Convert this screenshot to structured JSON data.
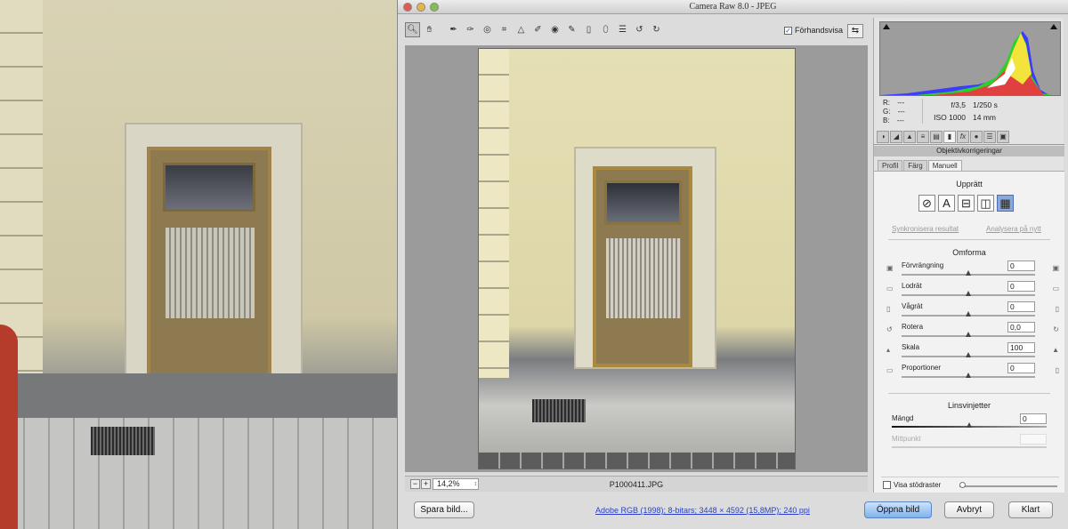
{
  "window": {
    "title": "Camera Raw 8.0  -  JPEG"
  },
  "toolbar": {
    "tools": [
      "zoom-icon",
      "hand-icon",
      "white-balance-icon",
      "color-sampler-icon",
      "targeted-adjust-icon",
      "crop-icon",
      "straighten-icon",
      "spot-removal-icon",
      "red-eye-icon",
      "adjustment-brush-icon",
      "graduated-filter-icon",
      "radial-filter-icon",
      "preferences-icon",
      "rotate-ccw-icon",
      "rotate-cw-icon"
    ],
    "preview_label": "Förhandsvisa",
    "preview_checked": true
  },
  "status": {
    "zoom": "14,2%",
    "filename": "P1000411.JPG"
  },
  "histogram": {
    "r": "R:",
    "g": "G:",
    "b": "B:",
    "r_val": "---",
    "g_val": "---",
    "b_val": "---"
  },
  "camera_info": {
    "aperture": "f/3,5",
    "shutter": "1/250 s",
    "iso": "ISO 1000",
    "focal": "14 mm"
  },
  "panel": {
    "tabs": [
      "basic-icon",
      "tone-curve-icon",
      "detail-icon",
      "hsl-icon",
      "split-toning-icon",
      "lens-corrections-icon",
      "effects-icon",
      "camera-calibration-icon",
      "presets-icon",
      "snapshots-icon"
    ],
    "section_title": "Objektivkorrigeringar",
    "subtabs": [
      "Profil",
      "Färg",
      "Manuell"
    ],
    "upright_title": "Upprätt",
    "sync_link": "Synkronisera resultat",
    "reanalyze_link": "Analysera på nytt",
    "transform_title": "Omforma",
    "sliders": [
      {
        "label": "Förvrängning",
        "value": "0",
        "pos": 0.5
      },
      {
        "label": "Lodrät",
        "value": "0",
        "pos": 0.5
      },
      {
        "label": "Vågrät",
        "value": "0",
        "pos": 0.5
      },
      {
        "label": "Rotera",
        "value": "0,0",
        "pos": 0.5
      },
      {
        "label": "Skala",
        "value": "100",
        "pos": 0.5
      },
      {
        "label": "Proportioner",
        "value": "0",
        "pos": 0.5
      }
    ],
    "vignette_title": "Linsvinjetter",
    "amount_label": "Mängd",
    "amount_value": "0",
    "amount_pos": 0.5,
    "midpoint_label": "Mittpunkt",
    "grid_label": "Visa stödraster"
  },
  "buttons": {
    "save": "Spara bild...",
    "workflow": "Adobe RGB (1998); 8-bitars; 3448 × 4592 (15,8MP); 240 ppi",
    "open": "Öppna bild",
    "cancel": "Avbryt",
    "done": "Klart"
  }
}
